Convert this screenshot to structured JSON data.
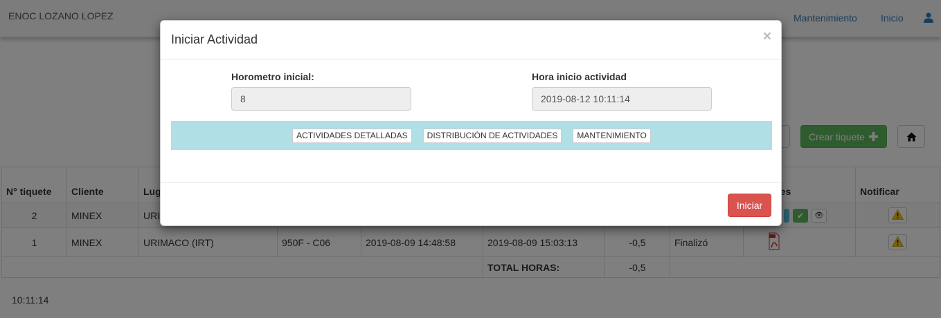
{
  "navbar": {
    "brand": "ENOC LOZANO LOPEZ",
    "links": [
      "Mantenimiento",
      "Inicio"
    ],
    "user_icon": "user-icon"
  },
  "toolbar": {
    "crear_label": "Crear tiquete",
    "crear_icon": "plus-icon",
    "home_icon": "home-icon"
  },
  "table": {
    "headers": [
      "N° tiquete",
      "Cliente",
      "Lug",
      "",
      "",
      "",
      "",
      "Acciones",
      "Notificar"
    ],
    "rows": [
      {
        "ticket": "2",
        "cliente": "MINEX",
        "lugar": "URI"
      },
      {
        "ticket": "1",
        "cliente": "MINEX",
        "lugar": "URIMACO (IRT)",
        "equipo": "950F - C06",
        "inicio": "2019-08-09 14:48:58",
        "fin": "2019-08-09 15:03:13",
        "horas": "-0,5",
        "estado": "Finalizó"
      }
    ],
    "total_label": "TOTAL HORAS:",
    "total_value": "-0,5"
  },
  "clock": "10:11:14",
  "modal": {
    "title": "Iniciar Actividad",
    "close": "×",
    "horometro_label": "Horometro inicial:",
    "horometro_value": "8",
    "hora_label": "Hora inicio actividad",
    "hora_value": "2019-08-12 10:11:14",
    "tabs": [
      "ACTIVIDADES DETALLADAS",
      "DISTRIBUCIÓN DE ACTIVIDADES",
      "MANTENIMIENTO"
    ],
    "submit_label": "Iniciar"
  },
  "colors": {
    "primary_link": "#337ab7",
    "success": "#5cb85c",
    "danger": "#d9534f",
    "tab_bar": "#b0dfe5",
    "warning": "#f0ad4e"
  }
}
